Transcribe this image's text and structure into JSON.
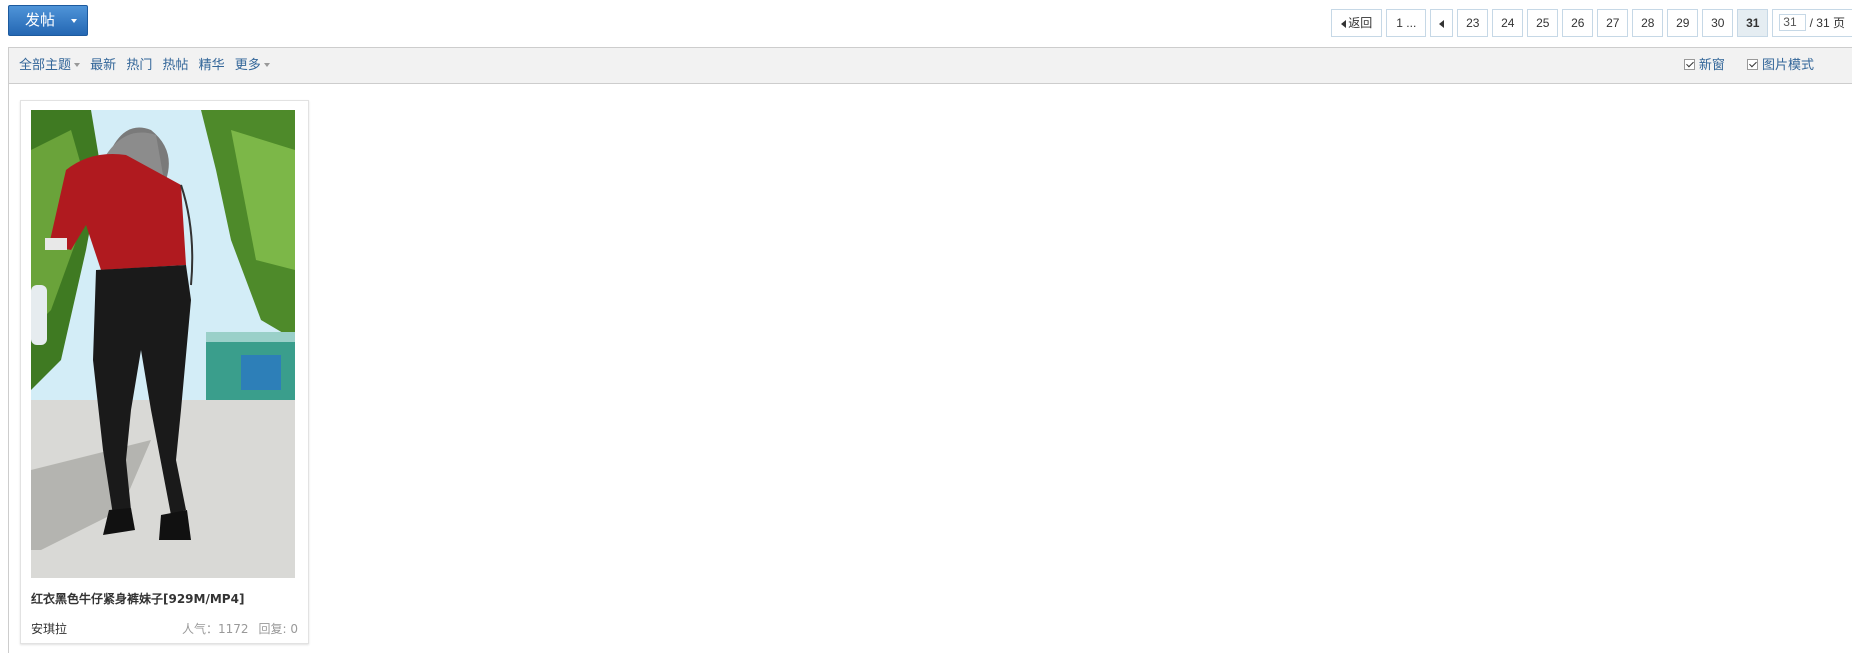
{
  "toolbar": {
    "post_button_label": "发帖"
  },
  "pager": {
    "back_label": "返回",
    "first_label": "1 ...",
    "pages": [
      "23",
      "24",
      "25",
      "26",
      "27",
      "28",
      "29",
      "30"
    ],
    "current_page": "31",
    "jump_value": "31",
    "total_label": "/ 31 页"
  },
  "filters": {
    "all_label": "全部主题",
    "newest_label": "最新",
    "hot_label": "热门",
    "hot_posts_label": "热帖",
    "digest_label": "精华",
    "more_label": "更多"
  },
  "options": {
    "new_window_label": "新窗",
    "image_mode_label": "图片模式"
  },
  "card": {
    "title": "红衣黑色牛仔紧身裤妹子[929M/MP4]",
    "author": "安琪拉",
    "views": "人气：1172",
    "replies": "回复: 0"
  },
  "colors": {
    "accent": "#2467b3",
    "link": "#336699",
    "filter_bg": "#f2f2f2"
  }
}
